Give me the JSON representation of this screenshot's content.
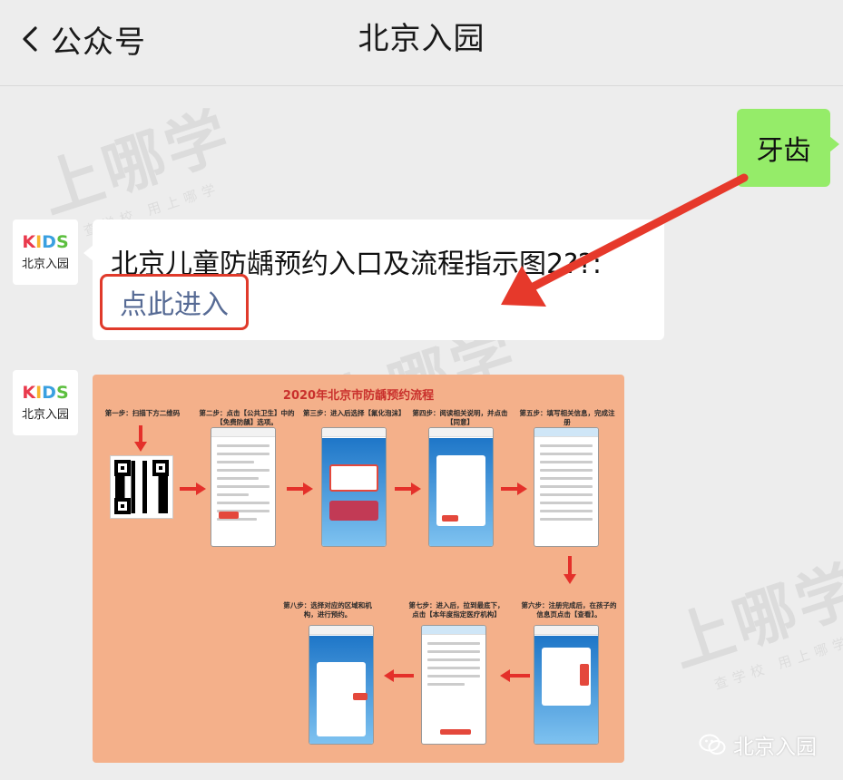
{
  "header": {
    "back_label": "公众号",
    "title": "北京入园"
  },
  "watermark": {
    "brand": "上哪学",
    "slogan": "查学校 用上哪学"
  },
  "avatar": {
    "kids_text": "KIDS",
    "name": "北京入园"
  },
  "messages": {
    "outgoing": "牙齿",
    "incoming_text": "北京儿童防龋预约入口及流程指示图2??:",
    "incoming_link": "点此进入"
  },
  "flow_image": {
    "title": "2020年北京市防龋预约流程",
    "steps": [
      "第一步：扫描下方二维码",
      "第二步：点击【公共卫生】中的【免费防龋】选项。",
      "第三步：进入后选择【氟化泡沫】",
      "第四步：阅读相关说明，并点击【同意】",
      "第五步：填写相关信息，完成注册",
      "第六步：注册完成后，在孩子的信息页点击【查看】。",
      "第七步：进入后，拉到最底下，点击【本年度指定医疗机构】",
      "第八步：选择对应的区域和机构，进行预约。"
    ]
  },
  "source_mark": {
    "name": "北京入园"
  },
  "colors": {
    "accent_red": "#e03a2b",
    "bubble_green": "#95ec69",
    "link_blue": "#576b95",
    "flow_bg": "#f4b08a"
  }
}
